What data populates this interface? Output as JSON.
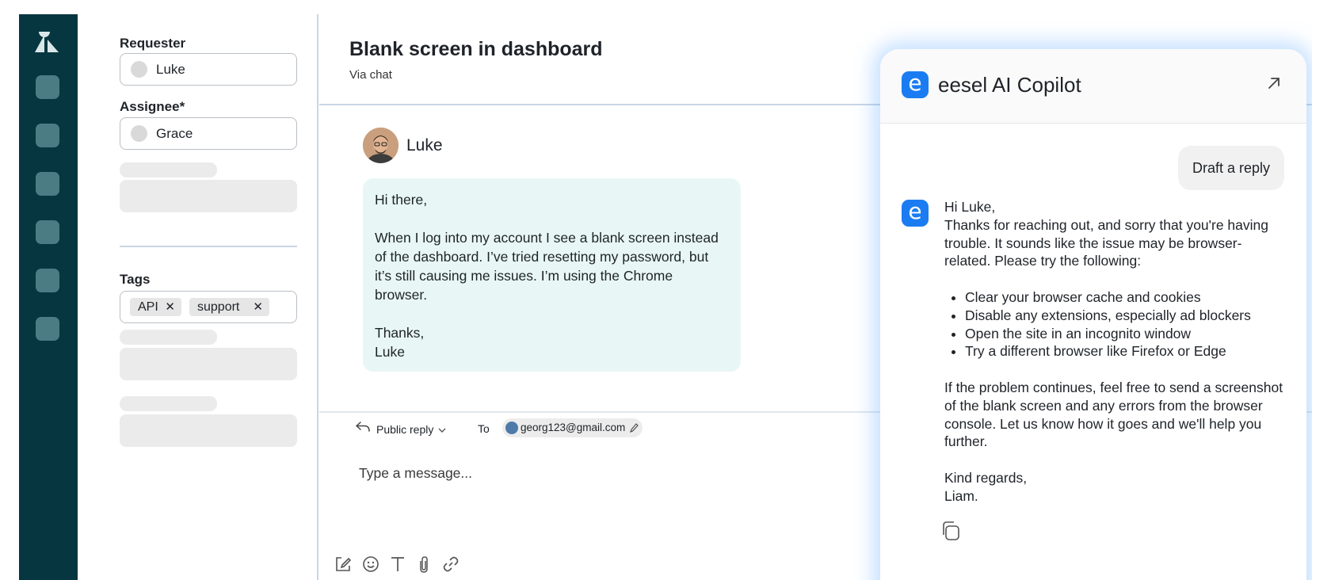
{
  "sidebar": {
    "logo_icon": "zendesk-logo-icon",
    "nav_count": 6
  },
  "properties": {
    "requester_label": "Requester",
    "requester_value": "Luke",
    "assignee_label": "Assignee*",
    "assignee_value": "Grace",
    "tags_label": "Tags",
    "tags": [
      {
        "label": "API",
        "remove": "✕"
      },
      {
        "label": "support",
        "remove": "✕"
      }
    ]
  },
  "ticket": {
    "title": "Blank screen in dashboard",
    "channel": "Via chat"
  },
  "message": {
    "sender": "Luke",
    "greeting": "Hi there,",
    "body": "When I log into my account I see a blank screen instead of the dashboard. I’ve tried resetting my password, but it’s still causing me issues. I’m using the Chrome browser.",
    "signoff": "Thanks,",
    "signature": "Luke"
  },
  "composer": {
    "reply_type": "Public reply",
    "to_label": "To",
    "recipient": "georg123@gmail.com",
    "placeholder": "Type a message...",
    "tools": [
      "compose-icon",
      "emoji-icon",
      "text-format-icon",
      "attachment-icon",
      "link-icon"
    ]
  },
  "copilot": {
    "title": "eesel AI Copilot",
    "logo_letter": "e",
    "expand_icon": "arrow-up-right-icon",
    "user_prompt": "Draft a reply",
    "reply": {
      "greeting": "Hi Luke,",
      "intro": "Thanks for reaching out, and sorry that you're having trouble. It sounds like the issue may be browser-related. Please try the following:",
      "steps": [
        "Clear your browser cache and cookies",
        "Disable any extensions, especially ad blockers",
        "Open the site in an incognito window",
        "Try a different browser like Firefox or Edge"
      ],
      "followup": "If the problem continues, feel free to send a screenshot of the blank screen and any errors from the browser console. Let us know how it goes and we'll help you further.",
      "closing": "Kind regards,",
      "name": "Liam."
    },
    "copy_icon": "copy-icon"
  },
  "colors": {
    "rail": "#06363f",
    "rail_button": "#4c7c83",
    "bubble": "#e8f7f6",
    "accent": "#1b7cf2"
  }
}
